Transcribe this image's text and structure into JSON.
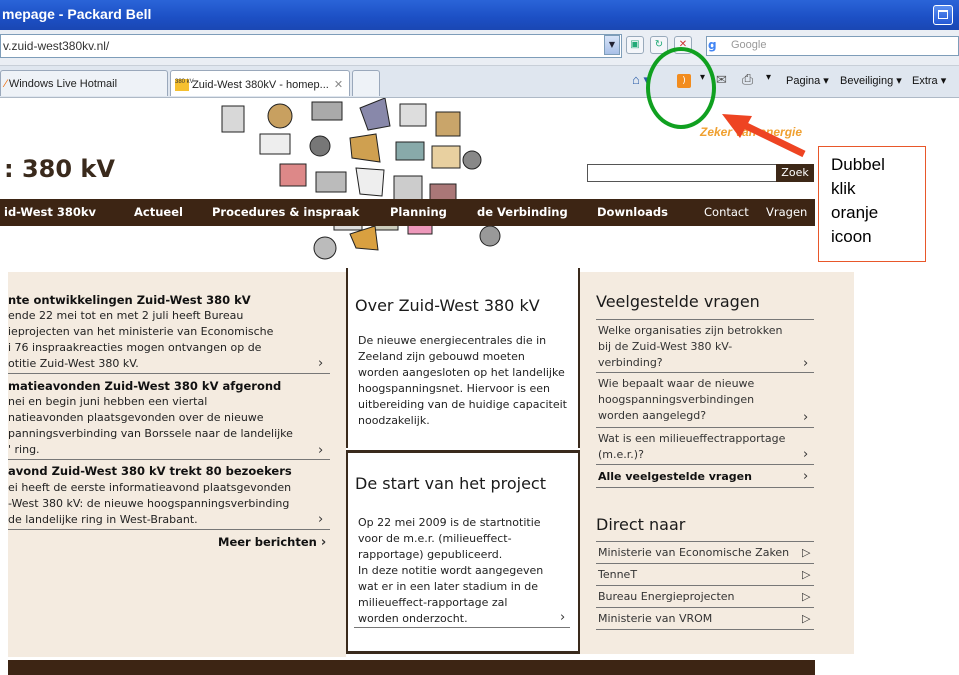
{
  "browser": {
    "title": "mepage - Packard Bell",
    "address": "v.zuid-west380kv.nl/",
    "search_placeholder": "Google",
    "tabs": [
      {
        "label": "Windows Live Hotmail"
      },
      {
        "label": "Zuid-West 380kV - homep...",
        "favicon": "380 kV"
      }
    ],
    "tools": {
      "pagina": "Pagina ▾",
      "beveiliging": "Beveiliging ▾",
      "extra": "Extra ▾"
    }
  },
  "site": {
    "logo": ": 380 kV",
    "tagline": "Zeker van energie",
    "search_button": "Zoek",
    "nav": [
      "id-West 380kv",
      "Actueel",
      "Procedures & inspraak",
      "Planning",
      "de Verbinding",
      "Downloads",
      "Contact",
      "Vragen"
    ]
  },
  "news": {
    "items": [
      {
        "title": "nte ontwikkelingen Zuid-West 380 kV",
        "lines": [
          "ende 22 mei tot en met 2 juli heeft Bureau",
          "ieprojecten van het ministerie van Economische",
          "i 76 inspraakreacties mogen ontvangen op de",
          "otitie Zuid-West 380 kV."
        ]
      },
      {
        "title": "matieavonden Zuid-West 380 kV afgerond",
        "lines": [
          "nei en begin juni hebben een viertal",
          "natieavonden plaatsgevonden over de nieuwe",
          "panningsverbinding van Borssele naar de landelijke",
          "' ring."
        ]
      },
      {
        "title": "avond Zuid-West 380 kV trekt 80 bezoekers",
        "lines": [
          "ei heeft de eerste informatieavond plaatsgevonden",
          "-West 380 kV: de nieuwe hoogspanningsverbinding",
          "de landelijke ring in West-Brabant."
        ]
      }
    ],
    "more": "Meer berichten"
  },
  "about": {
    "title": "Over Zuid-West 380 kV",
    "lines": [
      "De nieuwe energiecentrales die in",
      "Zeeland zijn gebouwd moeten",
      "worden aangesloten op het landelijke",
      "hoogspanningsnet. Hiervoor is een",
      "uitbereiding van de huidige capaciteit",
      "noodzakelijk."
    ]
  },
  "start": {
    "title": "De start van het project",
    "lines": [
      "Op 22 mei 2009 is de startnotitie",
      "voor de m.e.r. (milieueffect-",
      "rapportage) gepubliceerd.",
      "In deze notitie wordt aangegeven",
      "wat er in een later stadium in de",
      "milieueffect-rapportage zal",
      "worden onderzocht."
    ]
  },
  "faq": {
    "title": "Veelgestelde vragen",
    "items": [
      {
        "lines": [
          "Welke organisaties zijn betrokken",
          "bij de Zuid-West 380 kV-",
          "verbinding?"
        ]
      },
      {
        "lines": [
          "Wie bepaalt waar de nieuwe",
          "hoogspanningsverbindingen",
          "worden aangelegd?"
        ]
      },
      {
        "lines": [
          "Wat is een milieueffectrapportage",
          "(m.e.r.)?"
        ]
      }
    ],
    "all": "Alle veelgestelde vragen"
  },
  "direct": {
    "title": "Direct naar",
    "links": [
      "Ministerie van Economische Zaken",
      "TenneT",
      "Bureau Energieprojecten",
      "Ministerie van VROM"
    ]
  },
  "annotation": {
    "lines": [
      "Dubbel",
      "klik",
      "oranje",
      "icoon"
    ]
  }
}
